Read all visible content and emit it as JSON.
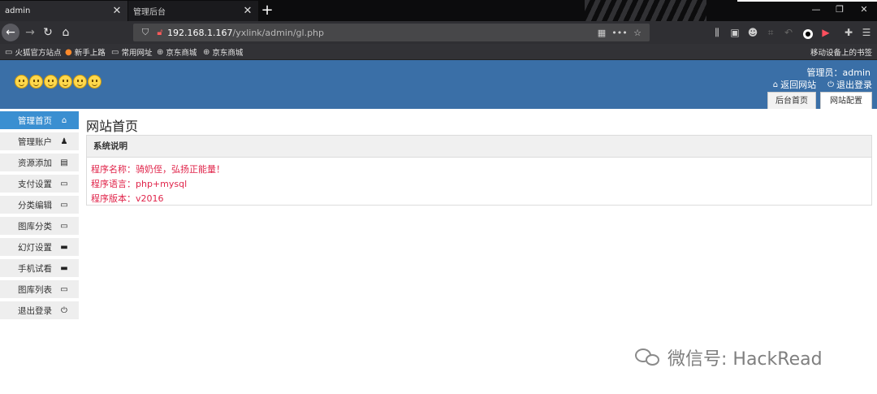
{
  "browser": {
    "tabs": [
      {
        "title": "admin",
        "close": "✕"
      },
      {
        "title": "管理后台",
        "close": "✕"
      }
    ],
    "new_tab": "+",
    "window_controls": [
      "—",
      "❐",
      "✕"
    ],
    "url": {
      "host": "192.168.1.167",
      "path": "/yxlink/admin/gl.php"
    },
    "nav_icons": {
      "back": "←",
      "forward": "→",
      "reload": "↻",
      "home": "⌂",
      "more": "•••",
      "star": "☆",
      "menu": "☰"
    },
    "toolbar_icons": [
      "⫼",
      "▣",
      "☻",
      "⌗",
      "↶",
      "●",
      "▶",
      "✚"
    ],
    "bookmarks": [
      {
        "label": "火狐官方站点",
        "icon": "folder-icon"
      },
      {
        "label": "新手上路",
        "icon": "firefox-icon"
      },
      {
        "label": "常用网址",
        "icon": "folder-icon"
      },
      {
        "label": "京东商城",
        "icon": "globe-icon"
      },
      {
        "label": "京东商城",
        "icon": "globe-icon"
      }
    ],
    "mobile_bookmarks": "移动设备上的书签"
  },
  "header": {
    "admin_label": "管理员：admin",
    "links": [
      {
        "label": "返回网站",
        "icon": "⌂"
      },
      {
        "label": "退出登录",
        "icon": "⏻"
      }
    ],
    "tabs": [
      "后台首页",
      "网站配置"
    ],
    "smiley_count": 6
  },
  "sidebar": {
    "items": [
      {
        "label": "管理首页",
        "icon": "⌂"
      },
      {
        "label": "管理账户",
        "icon": "♟"
      },
      {
        "label": "资源添加",
        "icon": "▤"
      },
      {
        "label": "支付设置",
        "icon": "▭"
      },
      {
        "label": "分类编辑",
        "icon": "▭"
      },
      {
        "label": "图库分类",
        "icon": "▭"
      },
      {
        "label": "幻灯设置",
        "icon": "▬"
      },
      {
        "label": "手机试看",
        "icon": "▬"
      },
      {
        "label": "图库列表",
        "icon": "▭"
      },
      {
        "label": "退出登录",
        "icon": "⏻"
      }
    ]
  },
  "main": {
    "title": "网站首页",
    "panel_title": "系统说明",
    "info": [
      "程序名称：骑奶侄，弘扬正能量！",
      "程序语言：php+mysql",
      "程序版本：v2016"
    ]
  },
  "watermark": "微信号: HackRead",
  "colors": {
    "header_bg": "#3a6fa7",
    "active_item": "#3a8fd1",
    "info_text": "#e0244a"
  }
}
